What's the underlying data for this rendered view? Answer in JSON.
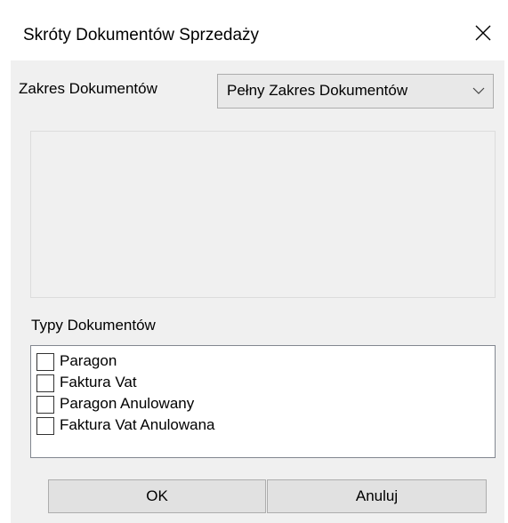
{
  "window": {
    "title": "Skróty Dokumentów Sprzedaży",
    "close_icon": "close-icon"
  },
  "range": {
    "label": "Zakres Dokumentów",
    "selected": "Pełny Zakres Dokumentów",
    "arrow_icon": "chevron-down-icon"
  },
  "types": {
    "label": "Typy Dokumentów",
    "items": [
      {
        "label": "Paragon",
        "checked": false
      },
      {
        "label": "Faktura Vat",
        "checked": false
      },
      {
        "label": "Paragon Anulowany",
        "checked": false
      },
      {
        "label": "Faktura Vat Anulowana",
        "checked": false
      }
    ]
  },
  "buttons": {
    "ok": "OK",
    "cancel": "Anuluj"
  },
  "colors": {
    "dialog_bg": "#f0f0f0",
    "title_bg": "#ffffff",
    "button_bg": "#e1e1e1",
    "border": "#adadad"
  }
}
